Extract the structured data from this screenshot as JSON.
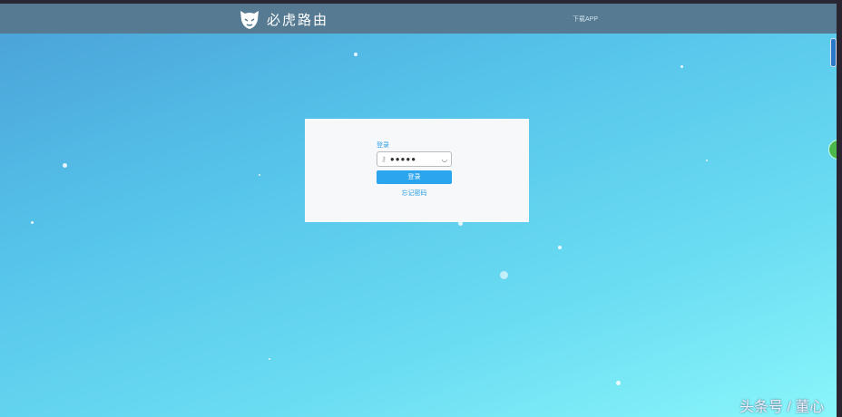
{
  "header": {
    "brand": "必虎路由",
    "download": "下载APP"
  },
  "login": {
    "title": "登录",
    "password_value": "●●●●●",
    "submit": "登录",
    "forgot": "忘记密码"
  },
  "watermark": "头条号 / 董心"
}
